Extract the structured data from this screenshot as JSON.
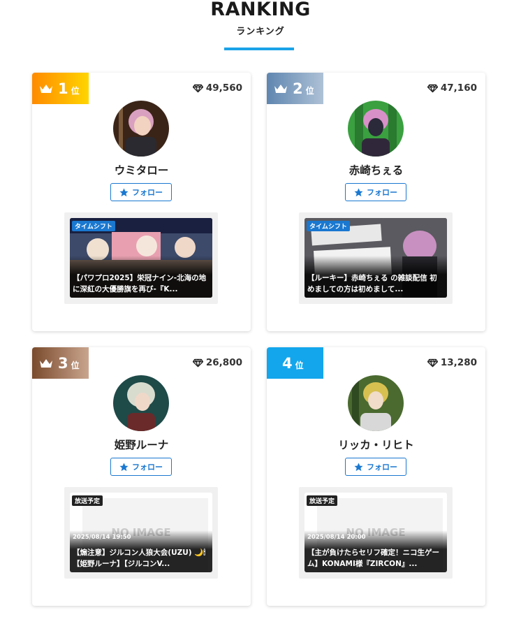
{
  "header": {
    "title": "RANKING",
    "subtitle": "ランキング"
  },
  "colors": {
    "accent": "#1aa3e8",
    "follow": "#1a78d0",
    "gold": "#ffb400",
    "silver": "#7d9bbf",
    "bronze": "#8a5a3c",
    "fourth": "#13a6ec"
  },
  "rank_suffix": "位",
  "follow_label": "フォロー",
  "cards": [
    {
      "rank": "1",
      "points": "49,560",
      "name": "ウミタロー",
      "thumb": {
        "tag": "タイムシフト",
        "date": "",
        "title": "【パワプロ2025】栄冠ナイン-北海の地に深紅の大優勝旗を再び-『K...",
        "no_image": ""
      }
    },
    {
      "rank": "2",
      "points": "47,160",
      "name": "赤崎ちぇる",
      "thumb": {
        "tag": "タイムシフト",
        "date": "",
        "title": "【ルーキー】赤崎ちぇる の雑談配信 初めましての方は初めまして...",
        "no_image": ""
      }
    },
    {
      "rank": "3",
      "points": "26,800",
      "name": "姫野ルーナ",
      "thumb": {
        "tag": "放送予定",
        "date": "2025/08/14 19:50",
        "title": "【煽注意】ジルコン人狼大会(UZU) 🌙🕯【姫野ルーナ】【ジルコンV...",
        "no_image": "NO IMAGE"
      }
    },
    {
      "rank": "4",
      "points": "13,280",
      "name": "リッカ・リヒト",
      "thumb": {
        "tag": "放送予定",
        "date": "2025/08/14 20:00",
        "title": "【主が負けたらセリフ確定！ニコ生ゲーム】KONAMI様『ZIRCON』...",
        "no_image": "NO IMAGE"
      }
    }
  ]
}
